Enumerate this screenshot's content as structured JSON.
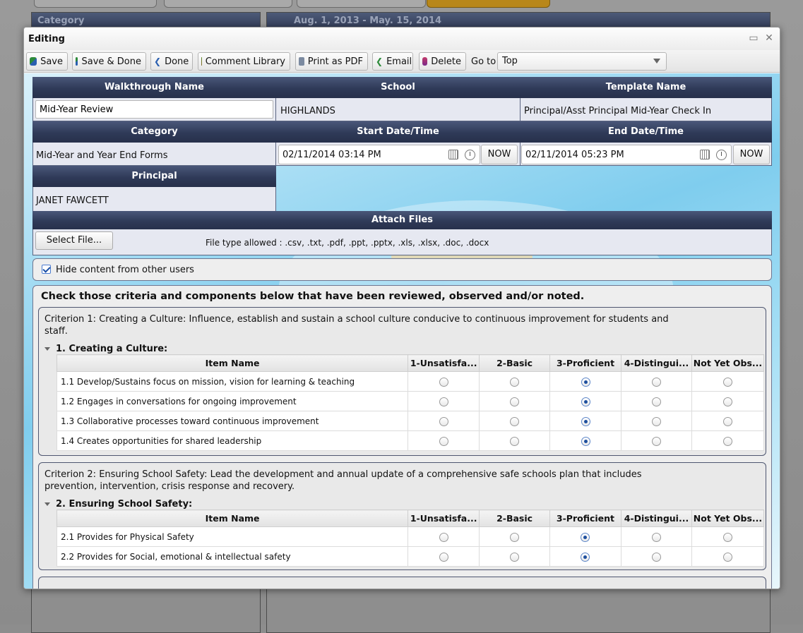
{
  "background": {
    "panel_left_title": "Category",
    "panel_right_title": "Aug. 1, 2013 - May. 15, 2014"
  },
  "modal": {
    "title": "Editing",
    "icons": {
      "maximize": "maximize-icon",
      "close": "close-icon"
    }
  },
  "toolbar": {
    "buttons": [
      {
        "label": "Save",
        "icon": "save-icon"
      },
      {
        "label": "Save & Done",
        "icon": "save-done-icon"
      },
      {
        "label": "Done",
        "icon": "done-arrow-icon"
      },
      {
        "label": "Comment Library",
        "icon": "comment-library-icon"
      },
      {
        "label": "Print as PDF",
        "icon": "print-icon"
      },
      {
        "label": "Email",
        "icon": "email-icon"
      },
      {
        "label": "Delete",
        "icon": "trash-icon"
      }
    ],
    "goto_label": "Go to",
    "goto_value": "Top"
  },
  "info": {
    "walkthrough_name_label": "Walkthrough Name",
    "walkthrough_name_value": "Mid-Year Review",
    "school_label": "School",
    "school_value": "HIGHLANDS",
    "template_label": "Template Name",
    "template_value": "Principal/Asst Principal Mid-Year Check In",
    "category_label": "Category",
    "category_value": "Mid-Year and Year End Forms",
    "start_label": "Start Date/Time",
    "start_value": "02/11/2014 03:14 PM",
    "end_label": "End Date/Time",
    "end_value": "02/11/2014 05:23 PM",
    "now_label": "NOW",
    "principal_label": "Principal",
    "principal_value": "JANET FAWCETT"
  },
  "attach": {
    "header": "Attach Files",
    "select_button": "Select File...",
    "allowed_text": "File type allowed : .csv, .txt, .pdf, .ppt, .pptx, .xls, .xlsx, .doc, .docx"
  },
  "hide_content": {
    "label": "Hide content from other users",
    "checked": true
  },
  "criteria": {
    "heading": "Check those criteria and components below that have been reviewed, observed and/or noted.",
    "columns": [
      "Item Name",
      "1-Unsatisfa...",
      "2-Basic",
      "3-Proficient",
      "4-Distingui...",
      "Not Yet Obs..."
    ],
    "list": [
      {
        "description": "Criterion 1: Creating a Culture: Influence, establish and sustain a school culture conducive to continuous improvement for students and staff.",
        "subtitle": "1. Creating a Culture:",
        "items": [
          {
            "name": "1.1 Develop/Sustains focus on mission, vision for learning & teaching",
            "selected": 3
          },
          {
            "name": "1.2 Engages in conversations for ongoing improvement",
            "selected": 3
          },
          {
            "name": "1.3 Collaborative processes toward continuous improvement",
            "selected": 3
          },
          {
            "name": "1.4 Creates opportunities for shared leadership",
            "selected": 3
          }
        ]
      },
      {
        "description": "Criterion 2: Ensuring School Safety: Lead the development and annual update of a comprehensive safe schools plan that includes prevention, intervention, crisis response and recovery.",
        "subtitle": "2. Ensuring School Safety:",
        "items": [
          {
            "name": "2.1 Provides for Physical Safety",
            "selected": 3
          },
          {
            "name": "2.2 Provides for Social, emotional & intellectual safety",
            "selected": 3
          }
        ]
      }
    ]
  }
}
